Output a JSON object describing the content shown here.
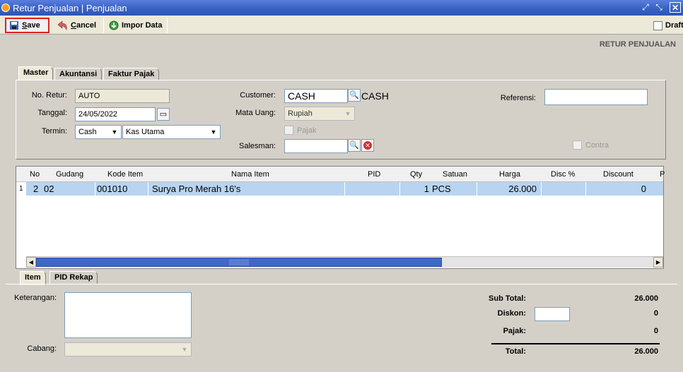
{
  "window": {
    "title": "Retur Penjualan | Penjualan"
  },
  "toolbar": {
    "save_hotkey": "S",
    "save_rest": "ave",
    "cancel_hotkey": "C",
    "cancel_rest": "ancel",
    "import_label": "Impor Data",
    "draft_label": "Draft"
  },
  "header_label": "RETUR PENJUALAN",
  "tabs": {
    "master": "Master",
    "akuntansi": "Akuntansi",
    "faktur": "Faktur Pajak"
  },
  "form": {
    "no_retur_label": "No. Retur:",
    "no_retur_value": "AUTO",
    "tanggal_label": "Tanggal:",
    "tanggal_value": "24/05/2022",
    "termin_label": "Termin:",
    "termin_value": "Cash",
    "kas_value": "Kas Utama",
    "customer_label": "Customer:",
    "customer_value": "CASH",
    "customer_name": "CASH",
    "mata_uang_label": "Mata Uang:",
    "mata_uang_value": "Rupiah",
    "pajak_label": "Pajak",
    "salesman_label": "Salesman:",
    "salesman_value": "",
    "referensi_label": "Referensi:",
    "referensi_value": "",
    "contra_label": "Contra"
  },
  "grid": {
    "columns": [
      "No",
      "Gudang",
      "Kode Item",
      "Nama Item",
      "PID",
      "Qty",
      "Satuan",
      "Harga",
      "Disc %",
      "Discount",
      "P"
    ],
    "rows": [
      {
        "row_num": "1",
        "no": "2",
        "gudang": "02",
        "kode": "001010",
        "nama": "Surya Pro Merah 16's",
        "pid": "",
        "qty": "1",
        "satuan": "PCS",
        "harga": "26.000",
        "disc_pct": "",
        "discount": "0"
      }
    ]
  },
  "bottom_tabs": {
    "item": "Item",
    "pid_rekap": "PID Rekap"
  },
  "bottom": {
    "keterangan_label": "Keterangan:",
    "keterangan_value": "",
    "cabang_label": "Cabang:",
    "cabang_value": ""
  },
  "totals": {
    "subtotal_label": "Sub Total:",
    "subtotal_value": "26.000",
    "diskon_label": "Diskon:",
    "diskon_value": "0",
    "diskon_input": "",
    "pajak_label": "Pajak:",
    "pajak_value": "0",
    "total_label": "Total:",
    "total_value": "26.000"
  }
}
